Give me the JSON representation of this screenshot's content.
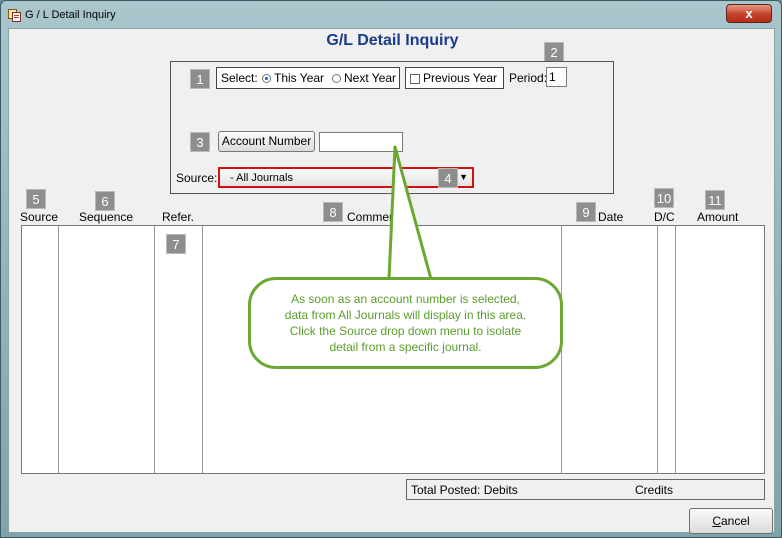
{
  "window": {
    "title": "G / L  Detail Inquiry",
    "close_glyph": "x"
  },
  "form": {
    "heading": "G/L Detail Inquiry"
  },
  "markers": [
    "1",
    "2",
    "3",
    "4",
    "5",
    "6",
    "7",
    "8",
    "9",
    "10",
    "11"
  ],
  "select_group": {
    "label": "Select:",
    "option_this_year": "This Year",
    "option_next_year": "Next Year",
    "selected": "This Year"
  },
  "previous_year": {
    "label": "Previous Year",
    "checked": false
  },
  "period": {
    "label": "Period:",
    "value": "1"
  },
  "account": {
    "button_label": "Account Number",
    "value": ""
  },
  "source": {
    "label": "Source:",
    "selected": "- All Journals"
  },
  "columns": {
    "source": "Source",
    "sequence": "Sequence",
    "refer": "Refer.",
    "comment": "Comment",
    "date": "Date",
    "dc": "D/C",
    "amount": "Amount"
  },
  "callout": {
    "lines": [
      "As soon as an account number is selected,",
      "data from All Journals will display in this area.",
      "Click the Source drop down menu to isolate",
      "detail from a specific journal."
    ]
  },
  "totals": {
    "posted_label": "Total Posted: Debits",
    "credits_label": "Credits"
  },
  "cancel": {
    "label_underlined": "C",
    "label_rest": "ancel"
  },
  "colors": {
    "heading": "#1a3a8c",
    "callout_border": "#6aa832",
    "callout_text": "#5a9e29",
    "source_highlight": "#d40f0f",
    "marker_bg": "#8e8e8e"
  }
}
